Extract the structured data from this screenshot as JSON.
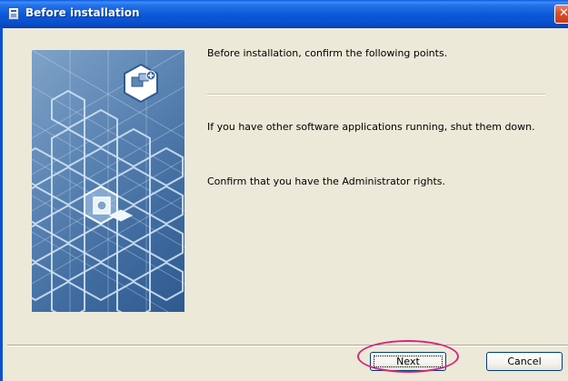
{
  "window": {
    "title": "Before installation",
    "close_glyph": "✕"
  },
  "content": {
    "intro": "Before installation, confirm the following points.",
    "point1": "If you have other software applications running, shut them down.",
    "point2": "Confirm that you have the Administrator rights."
  },
  "buttons": {
    "next": "Next",
    "cancel": "Cancel"
  },
  "colors": {
    "titlebar": "#0a52cf",
    "dialog_bg": "#ece9d8",
    "highlight": "#d4287e",
    "banner": "#4a76a8"
  },
  "icons": {
    "app": "installer-app-icon",
    "close": "close-icon",
    "banner_badge": "printer-add-icon",
    "banner_device": "device-cube-icon"
  }
}
